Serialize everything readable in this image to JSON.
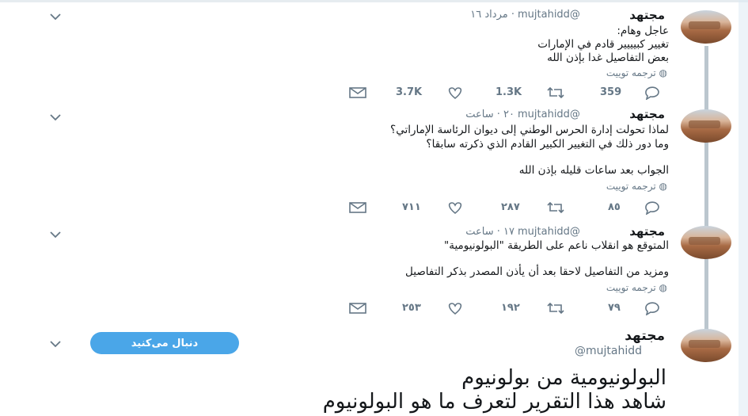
{
  "tweets": [
    {
      "name": "مجتهد",
      "handle": "mujtahidd@",
      "time": "· مرداد ١٦",
      "lines": [
        "عاجل وهام:",
        "تغيير كبيييير قادم في الإمارات",
        "بعض التفاصيل غدا بإذن الله"
      ],
      "translate": "ترجمه توییت",
      "replies": "359",
      "retweets": "1.3K",
      "likes": "3.7K"
    },
    {
      "name": "مجتهد",
      "handle": "mujtahidd@",
      "time": "۲۰ · ساعت",
      "lines": [
        "لماذا تحولت إدارة الحرس الوطني إلى ديوان الرئاسة الإماراتي؟",
        "وما دور ذلك في التغيير الكبير القادم الذي ذكرته سابقا؟",
        "",
        "الجواب بعد ساعات قليله بإذن الله"
      ],
      "translate": "ترجمه توییت",
      "replies": "٨٥",
      "retweets": "٢٨٧",
      "likes": "٧١١"
    },
    {
      "name": "مجتهد",
      "handle": "mujtahidd@",
      "time": "۱۷ · ساعت",
      "lines": [
        "المتوقع هو انقلاب ناعم على الطريقة \"البولونيومية\"",
        "",
        "ومزيد من التفاصيل لاحقا بعد أن يأذن المصدر بذكر التفاصيل"
      ],
      "translate": "ترجمه توییت",
      "replies": "٧٩",
      "retweets": "١٩٢",
      "likes": "٢٥٣"
    }
  ],
  "featured": {
    "name": "مجتهد",
    "handle": "@mujtahidd",
    "follow_label": "دنبال می‌کنید",
    "lines": [
      "البولونيومية من بولونيوم",
      "شاهد هذا التقرير لتعرف ما هو البولونيوم"
    ]
  },
  "icons": {
    "reply": "reply-icon",
    "retweet": "retweet-icon",
    "like": "heart-icon",
    "dm": "envelope-icon",
    "more": "chevron-down-icon",
    "translate": "globe-icon"
  },
  "colors": {
    "follow": "#4aa6e8",
    "muted": "#657786",
    "thread": "#aab8c2"
  }
}
